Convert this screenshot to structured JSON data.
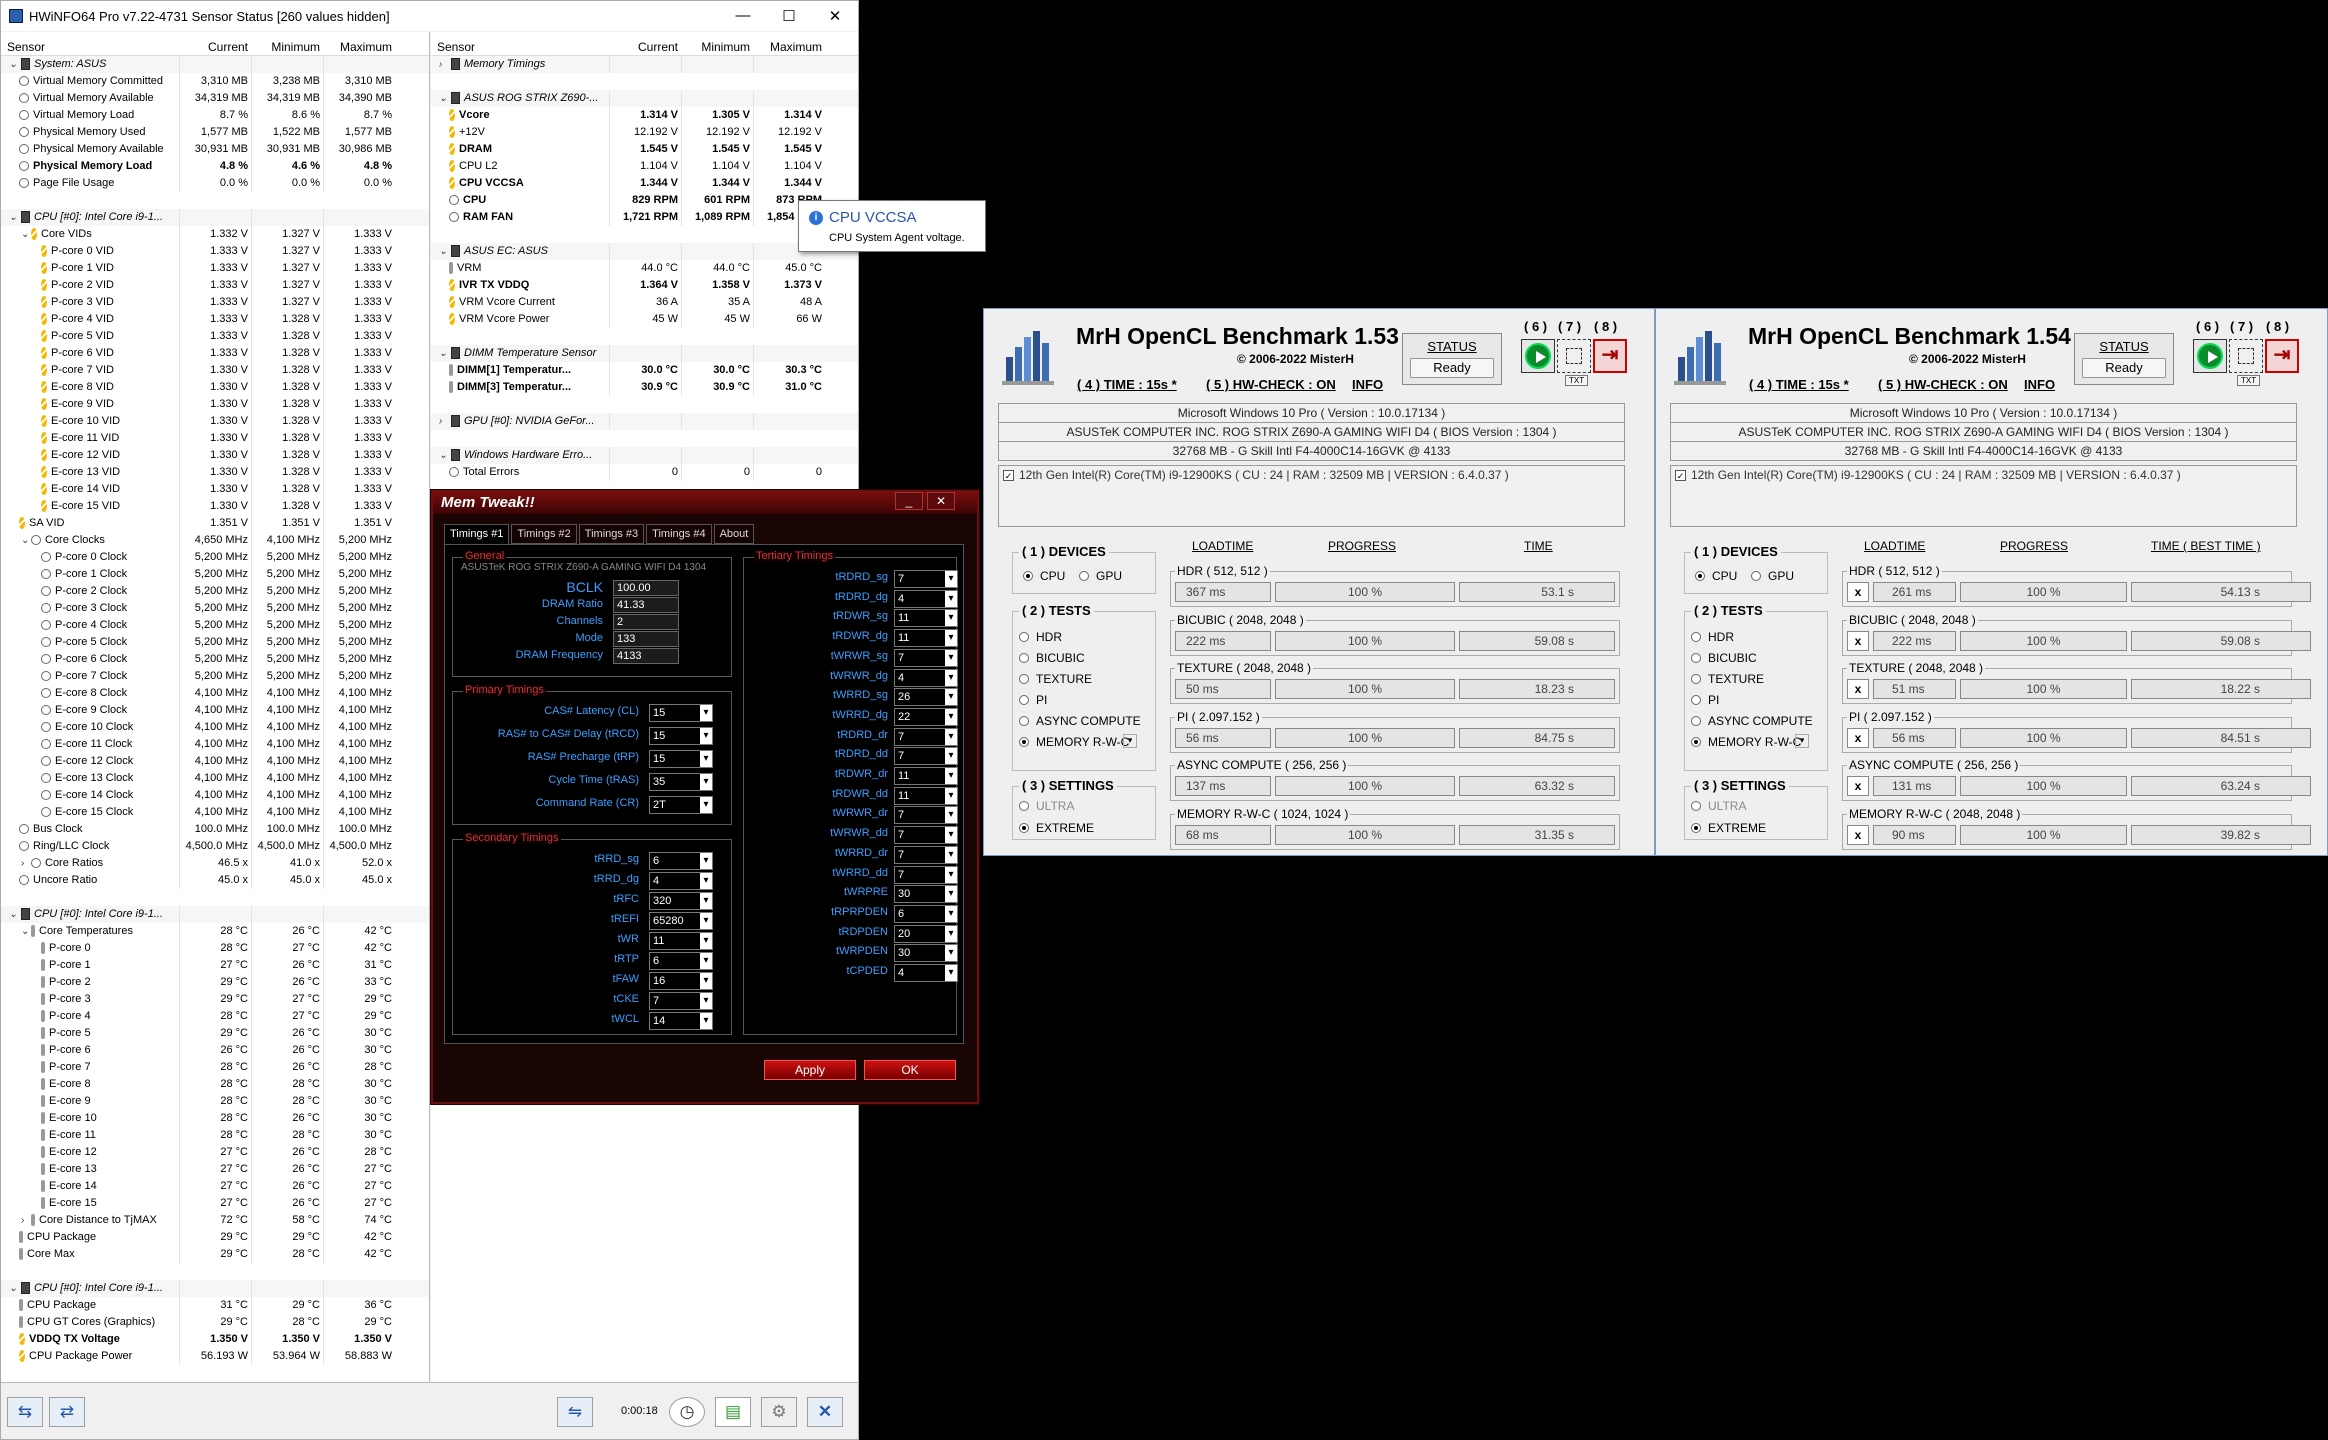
{
  "hwinfo": {
    "title": "HWiNFO64 Pro v7.22-4731 Sensor Status [260 values hidden]",
    "columns": [
      "Sensor",
      "Current",
      "Minimum",
      "Maximum"
    ],
    "left_rows": [
      [
        "g",
        "System: ASUS",
        "",
        "",
        ""
      ],
      [
        "c",
        "Virtual Memory Committed",
        "3,310 MB",
        "3,238 MB",
        "3,310 MB"
      ],
      [
        "c",
        "Virtual Memory Available",
        "34,319 MB",
        "34,319 MB",
        "34,390 MB"
      ],
      [
        "c",
        "Virtual Memory Load",
        "8.7 %",
        "8.6 %",
        "8.7 %"
      ],
      [
        "c",
        "Physical Memory Used",
        "1,577 MB",
        "1,522 MB",
        "1,577 MB"
      ],
      [
        "c",
        "Physical Memory Available",
        "30,931 MB",
        "30,931 MB",
        "30,986 MB"
      ],
      [
        "cb",
        "Physical Memory Load",
        "4.8 %",
        "4.6 %",
        "4.8 %"
      ],
      [
        "c",
        "Page File Usage",
        "0.0 %",
        "0.0 %",
        "0.0 %"
      ],
      [
        "x",
        "",
        "",
        "",
        ""
      ],
      [
        "g",
        "CPU [#0]: Intel Core i9-1...",
        "",
        "",
        ""
      ],
      [
        "v1",
        "Core VIDs",
        "1.332 V",
        "1.327 V",
        "1.333 V"
      ],
      [
        "v2",
        "P-core 0 VID",
        "1.333 V",
        "1.327 V",
        "1.333 V"
      ],
      [
        "v2",
        "P-core 1 VID",
        "1.333 V",
        "1.327 V",
        "1.333 V"
      ],
      [
        "v2",
        "P-core 2 VID",
        "1.333 V",
        "1.327 V",
        "1.333 V"
      ],
      [
        "v2",
        "P-core 3 VID",
        "1.333 V",
        "1.327 V",
        "1.333 V"
      ],
      [
        "v2",
        "P-core 4 VID",
        "1.333 V",
        "1.328 V",
        "1.333 V"
      ],
      [
        "v2",
        "P-core 5 VID",
        "1.333 V",
        "1.328 V",
        "1.333 V"
      ],
      [
        "v2",
        "P-core 6 VID",
        "1.333 V",
        "1.328 V",
        "1.333 V"
      ],
      [
        "v2",
        "P-core 7 VID",
        "1.330 V",
        "1.328 V",
        "1.333 V"
      ],
      [
        "v2",
        "E-core 8 VID",
        "1.330 V",
        "1.328 V",
        "1.333 V"
      ],
      [
        "v2",
        "E-core 9 VID",
        "1.330 V",
        "1.328 V",
        "1.333 V"
      ],
      [
        "v2",
        "E-core 10 VID",
        "1.330 V",
        "1.328 V",
        "1.333 V"
      ],
      [
        "v2",
        "E-core 11 VID",
        "1.330 V",
        "1.328 V",
        "1.333 V"
      ],
      [
        "v2",
        "E-core 12 VID",
        "1.330 V",
        "1.328 V",
        "1.333 V"
      ],
      [
        "v2",
        "E-core 13 VID",
        "1.330 V",
        "1.328 V",
        "1.333 V"
      ],
      [
        "v2",
        "E-core 14 VID",
        "1.330 V",
        "1.328 V",
        "1.333 V"
      ],
      [
        "v2",
        "E-core 15 VID",
        "1.330 V",
        "1.328 V",
        "1.333 V"
      ],
      [
        "v",
        "SA VID",
        "1.351 V",
        "1.351 V",
        "1.351 V"
      ],
      [
        "c1",
        "Core Clocks",
        "4,650 MHz",
        "4,100 MHz",
        "5,200 MHz"
      ],
      [
        "c2",
        "P-core 0 Clock",
        "5,200 MHz",
        "5,200 MHz",
        "5,200 MHz"
      ],
      [
        "c2",
        "P-core 1 Clock",
        "5,200 MHz",
        "5,200 MHz",
        "5,200 MHz"
      ],
      [
        "c2",
        "P-core 2 Clock",
        "5,200 MHz",
        "5,200 MHz",
        "5,200 MHz"
      ],
      [
        "c2",
        "P-core 3 Clock",
        "5,200 MHz",
        "5,200 MHz",
        "5,200 MHz"
      ],
      [
        "c2",
        "P-core 4 Clock",
        "5,200 MHz",
        "5,200 MHz",
        "5,200 MHz"
      ],
      [
        "c2",
        "P-core 5 Clock",
        "5,200 MHz",
        "5,200 MHz",
        "5,200 MHz"
      ],
      [
        "c2",
        "P-core 6 Clock",
        "5,200 MHz",
        "5,200 MHz",
        "5,200 MHz"
      ],
      [
        "c2",
        "P-core 7 Clock",
        "5,200 MHz",
        "5,200 MHz",
        "5,200 MHz"
      ],
      [
        "c2",
        "E-core 8 Clock",
        "4,100 MHz",
        "4,100 MHz",
        "4,100 MHz"
      ],
      [
        "c2",
        "E-core 9 Clock",
        "4,100 MHz",
        "4,100 MHz",
        "4,100 MHz"
      ],
      [
        "c2",
        "E-core 10 Clock",
        "4,100 MHz",
        "4,100 MHz",
        "4,100 MHz"
      ],
      [
        "c2",
        "E-core 11 Clock",
        "4,100 MHz",
        "4,100 MHz",
        "4,100 MHz"
      ],
      [
        "c2",
        "E-core 12 Clock",
        "4,100 MHz",
        "4,100 MHz",
        "4,100 MHz"
      ],
      [
        "c2",
        "E-core 13 Clock",
        "4,100 MHz",
        "4,100 MHz",
        "4,100 MHz"
      ],
      [
        "c2",
        "E-core 14 Clock",
        "4,100 MHz",
        "4,100 MHz",
        "4,100 MHz"
      ],
      [
        "c2",
        "E-core 15 Clock",
        "4,100 MHz",
        "4,100 MHz",
        "4,100 MHz"
      ],
      [
        "c",
        "Bus Clock",
        "100.0 MHz",
        "100.0 MHz",
        "100.0 MHz"
      ],
      [
        "c",
        "Ring/LLC Clock",
        "4,500.0 MHz",
        "4,500.0 MHz",
        "4,500.0 MHz"
      ],
      [
        "c1r",
        "Core Ratios",
        "46.5 x",
        "41.0 x",
        "52.0 x"
      ],
      [
        "c",
        "Uncore Ratio",
        "45.0 x",
        "45.0 x",
        "45.0 x"
      ],
      [
        "x",
        "",
        "",
        "",
        ""
      ],
      [
        "g",
        "CPU [#0]: Intel Core i9-1...",
        "",
        "",
        ""
      ],
      [
        "t1",
        "Core Temperatures",
        "28 °C",
        "26 °C",
        "42 °C"
      ],
      [
        "t2",
        "P-core 0",
        "28 °C",
        "27 °C",
        "42 °C"
      ],
      [
        "t2",
        "P-core 1",
        "27 °C",
        "26 °C",
        "31 °C"
      ],
      [
        "t2",
        "P-core 2",
        "29 °C",
        "26 °C",
        "33 °C"
      ],
      [
        "t2",
        "P-core 3",
        "29 °C",
        "27 °C",
        "29 °C"
      ],
      [
        "t2",
        "P-core 4",
        "28 °C",
        "27 °C",
        "29 °C"
      ],
      [
        "t2",
        "P-core 5",
        "29 °C",
        "26 °C",
        "30 °C"
      ],
      [
        "t2",
        "P-core 6",
        "26 °C",
        "26 °C",
        "30 °C"
      ],
      [
        "t2",
        "P-core 7",
        "28 °C",
        "26 °C",
        "28 °C"
      ],
      [
        "t2",
        "E-core 8",
        "28 °C",
        "28 °C",
        "30 °C"
      ],
      [
        "t2",
        "E-core 9",
        "28 °C",
        "28 °C",
        "30 °C"
      ],
      [
        "t2",
        "E-core 10",
        "28 °C",
        "26 °C",
        "30 °C"
      ],
      [
        "t2",
        "E-core 11",
        "28 °C",
        "28 °C",
        "30 °C"
      ],
      [
        "t2",
        "E-core 12",
        "27 °C",
        "26 °C",
        "28 °C"
      ],
      [
        "t2",
        "E-core 13",
        "27 °C",
        "26 °C",
        "27 °C"
      ],
      [
        "t2",
        "E-core 14",
        "27 °C",
        "26 °C",
        "27 °C"
      ],
      [
        "t2",
        "E-core 15",
        "27 °C",
        "26 °C",
        "27 °C"
      ],
      [
        "t1r",
        "Core Distance to TjMAX",
        "72 °C",
        "58 °C",
        "74 °C"
      ],
      [
        "t",
        "CPU Package",
        "29 °C",
        "29 °C",
        "42 °C"
      ],
      [
        "t",
        "Core Max",
        "29 °C",
        "28 °C",
        "42 °C"
      ],
      [
        "x",
        "",
        "",
        "",
        ""
      ],
      [
        "g",
        "CPU [#0]: Intel Core i9-1...",
        "",
        "",
        ""
      ],
      [
        "t",
        "CPU Package",
        "31 °C",
        "29 °C",
        "36 °C"
      ],
      [
        "t",
        "CPU GT Cores (Graphics)",
        "29 °C",
        "28 °C",
        "29 °C"
      ],
      [
        "vb",
        "VDDQ TX Voltage",
        "1.350 V",
        "1.350 V",
        "1.350 V"
      ],
      [
        "v",
        "CPU Package Power",
        "56.193 W",
        "53.964 W",
        "58.883 W"
      ]
    ],
    "right_rows": [
      [
        "gr",
        "Memory Timings",
        "",
        "",
        ""
      ],
      [
        "x",
        "",
        "",
        "",
        ""
      ],
      [
        "g",
        "ASUS ROG STRIX Z690-...",
        "",
        "",
        ""
      ],
      [
        "vb",
        "Vcore",
        "1.314 V",
        "1.305 V",
        "1.314 V"
      ],
      [
        "v",
        "+12V",
        "12.192 V",
        "12.192 V",
        "12.192 V"
      ],
      [
        "vb",
        "DRAM",
        "1.545 V",
        "1.545 V",
        "1.545 V"
      ],
      [
        "v",
        "CPU L2",
        "1.104 V",
        "1.104 V",
        "1.104 V"
      ],
      [
        "vb",
        "CPU VCCSA",
        "1.344 V",
        "1.344 V",
        "1.344 V"
      ],
      [
        "cb",
        "CPU",
        "829 RPM",
        "601 RPM",
        "873 RPM"
      ],
      [
        "cb",
        "RAM FAN",
        "1,721 RPM",
        "1,089 RPM",
        "1,854 RPM"
      ],
      [
        "x",
        "",
        "",
        "",
        ""
      ],
      [
        "g",
        "ASUS EC: ASUS",
        "",
        "",
        ""
      ],
      [
        "t",
        "VRM",
        "44.0 °C",
        "44.0 °C",
        "45.0 °C"
      ],
      [
        "vb",
        "IVR TX VDDQ",
        "1.364 V",
        "1.358 V",
        "1.373 V"
      ],
      [
        "v",
        "VRM Vcore Current",
        "36 A",
        "35 A",
        "48 A"
      ],
      [
        "v",
        "VRM Vcore Power",
        "45 W",
        "45 W",
        "66 W"
      ],
      [
        "x",
        "",
        "",
        "",
        ""
      ],
      [
        "g",
        "DIMM Temperature Sensor",
        "",
        "",
        ""
      ],
      [
        "tb",
        "DIMM[1] Temperatur...",
        "30.0 °C",
        "30.0 °C",
        "30.3 °C"
      ],
      [
        "tb",
        "DIMM[3] Temperatur...",
        "30.9 °C",
        "30.9 °C",
        "31.0 °C"
      ],
      [
        "x",
        "",
        "",
        "",
        ""
      ],
      [
        "gr",
        "GPU [#0]: NVIDIA GeFor...",
        "",
        "",
        ""
      ],
      [
        "x",
        "",
        "",
        "",
        ""
      ],
      [
        "g",
        "Windows Hardware Erro...",
        "",
        "",
        ""
      ],
      [
        "c",
        "Total Errors",
        "0",
        "0",
        "0"
      ]
    ],
    "elapsed": "0:00:18",
    "tooltip": {
      "title": "CPU VCCSA",
      "text": "CPU System Agent voltage."
    }
  },
  "memtweak": {
    "title": "Mem Tweak!!",
    "tabs": [
      "Timings #1",
      "Timings #2",
      "Timings #3",
      "Timings #4",
      "About"
    ],
    "general": {
      "label": "General",
      "board": "ASUSTeK ROG STRIX Z690-A GAMING WIFI D4 1304",
      "fields": [
        [
          "BCLK",
          "100.00"
        ],
        [
          "DRAM Ratio",
          "41.33"
        ],
        [
          "Channels",
          "2"
        ],
        [
          "Mode",
          "133"
        ],
        [
          "DRAM Frequency",
          "4133"
        ]
      ]
    },
    "primary": {
      "label": "Primary Timings",
      "fields": [
        [
          "CAS# Latency (CL)",
          "15"
        ],
        [
          "RAS# to CAS# Delay (tRCD)",
          "15"
        ],
        [
          "RAS# Precharge (tRP)",
          "15"
        ],
        [
          "Cycle Time (tRAS)",
          "35"
        ],
        [
          "Command Rate (CR)",
          "2T"
        ]
      ]
    },
    "secondary": {
      "label": "Secondary Timings",
      "fields": [
        [
          "tRRD_sg",
          "6"
        ],
        [
          "tRRD_dg",
          "4"
        ],
        [
          "tRFC",
          "320"
        ],
        [
          "tREFI",
          "65280"
        ],
        [
          "tWR",
          "11"
        ],
        [
          "tRTP",
          "6"
        ],
        [
          "tFAW",
          "16"
        ],
        [
          "tCKE",
          "7"
        ],
        [
          "tWCL",
          "14"
        ]
      ]
    },
    "tertiary": {
      "label": "Tertiary Timings",
      "fields": [
        [
          "tRDRD_sg",
          "7"
        ],
        [
          "tRDRD_dg",
          "4"
        ],
        [
          "tRDWR_sg",
          "11"
        ],
        [
          "tRDWR_dg",
          "11"
        ],
        [
          "tWRWR_sg",
          "7"
        ],
        [
          "tWRWR_dg",
          "4"
        ],
        [
          "tWRRD_sg",
          "26"
        ],
        [
          "tWRRD_dg",
          "22"
        ],
        [
          "tRDRD_dr",
          "7"
        ],
        [
          "tRDRD_dd",
          "7"
        ],
        [
          "tRDWR_dr",
          "11"
        ],
        [
          "tRDWR_dd",
          "11"
        ],
        [
          "tWRWR_dr",
          "7"
        ],
        [
          "tWRWR_dd",
          "7"
        ],
        [
          "tWRRD_dr",
          "7"
        ],
        [
          "tWRRD_dd",
          "7"
        ],
        [
          "tWRPRE",
          "30"
        ],
        [
          "tRPRPDEN",
          "6"
        ],
        [
          "tRDPDEN",
          "20"
        ],
        [
          "tWRPDEN",
          "30"
        ],
        [
          "tCPDED",
          "4"
        ]
      ]
    },
    "apply": "Apply",
    "ok": "OK"
  },
  "benches": [
    {
      "title": "MrH OpenCL Benchmark 1.53",
      "copyright": "© 2006-2022 MisterH",
      "status_label": "STATUS",
      "status": "Ready",
      "n6": "( 6 )",
      "n7": "( 7 )",
      "n8": "( 8 )",
      "txt": "TXT",
      "time_link": "( 4 ) TIME : 15s *",
      "hw_link": "( 5 ) HW-CHECK : ON",
      "info_link": "INFO",
      "info": [
        "Microsoft Windows 10 Pro ( Version : 10.0.17134 )",
        "ASUSTeK COMPUTER INC. ROG STRIX Z690-A GAMING WIFI D4 ( BIOS Version : 1304 )",
        "32768 MB - G Skill Intl F4-4000C14-16GVK    @ 4133"
      ],
      "cpu_line": "12th Gen Intel(R) Core(TM) i9-12900KS ( CU : 24 | RAM : 32509 MB | VERSION : 6.4.0.37 )",
      "devices": "( 1 ) DEVICES",
      "cpu": "CPU",
      "gpu": "GPU",
      "tests": "( 2 ) TESTS",
      "test_list": [
        "HDR",
        "BICUBIC",
        "TEXTURE",
        "PI",
        "ASYNC COMPUTE",
        "MEMORY R-W-C"
      ],
      "settings": "( 3 ) SETTINGS",
      "ultra": "ULTRA",
      "extreme": "EXTREME",
      "col_load": "LOADTIME",
      "col_prog": "PROGRESS",
      "col_time": "TIME",
      "results": [
        [
          "HDR ( 512, 512 )",
          "367 ms",
          "100 %",
          "53.1 s"
        ],
        [
          "BICUBIC ( 2048, 2048 )",
          "222 ms",
          "100 %",
          "59.08 s"
        ],
        [
          "TEXTURE ( 2048, 2048 )",
          "50 ms",
          "100 %",
          "18.23 s"
        ],
        [
          "PI ( 2.097.152 )",
          "56 ms",
          "100 %",
          "84.75 s"
        ],
        [
          "ASYNC COMPUTE ( 256, 256 )",
          "137 ms",
          "100 %",
          "63.32 s"
        ],
        [
          "MEMORY R-W-C ( 1024, 1024 )",
          "68 ms",
          "100 %",
          "31.35 s"
        ]
      ],
      "x": false
    },
    {
      "title": "MrH OpenCL Benchmark 1.54",
      "copyright": "© 2006-2022 MisterH",
      "status_label": "STATUS",
      "status": "Ready",
      "n6": "( 6 )",
      "n7": "( 7 )",
      "n8": "( 8 )",
      "txt": "TXT",
      "time_link": "( 4 ) TIME : 15s *",
      "hw_link": "( 5 ) HW-CHECK : ON",
      "info_link": "INFO",
      "info": [
        "Microsoft Windows 10 Pro ( Version : 10.0.17134 )",
        "ASUSTeK COMPUTER INC. ROG STRIX Z690-A GAMING WIFI D4 ( BIOS Version : 1304 )",
        "32768 MB - G Skill Intl F4-4000C14-16GVK    @ 4133"
      ],
      "cpu_line": "12th Gen Intel(R) Core(TM) i9-12900KS ( CU : 24 | RAM : 32509 MB | VERSION : 6.4.0.37 )",
      "devices": "( 1 ) DEVICES",
      "cpu": "CPU",
      "gpu": "GPU",
      "tests": "( 2 ) TESTS",
      "test_list": [
        "HDR",
        "BICUBIC",
        "TEXTURE",
        "PI",
        "ASYNC COMPUTE",
        "MEMORY R-W-C"
      ],
      "settings": "( 3 ) SETTINGS",
      "ultra": "ULTRA",
      "extreme": "EXTREME",
      "col_load": "LOADTIME",
      "col_prog": "PROGRESS",
      "col_time": "TIME ( BEST TIME )",
      "results": [
        [
          "HDR ( 512, 512 )",
          "261 ms",
          "100 %",
          "54.13 s"
        ],
        [
          "BICUBIC ( 2048, 2048 )",
          "222 ms",
          "100 %",
          "59.08 s"
        ],
        [
          "TEXTURE ( 2048, 2048 )",
          "51 ms",
          "100 %",
          "18.22 s"
        ],
        [
          "PI ( 2.097.152 )",
          "56 ms",
          "100 %",
          "84.51 s"
        ],
        [
          "ASYNC COMPUTE ( 256, 256 )",
          "131 ms",
          "100 %",
          "63.24 s"
        ],
        [
          "MEMORY R-W-C ( 2048, 2048 )",
          "90 ms",
          "100 %",
          "39.82 s"
        ]
      ],
      "x": true
    }
  ]
}
